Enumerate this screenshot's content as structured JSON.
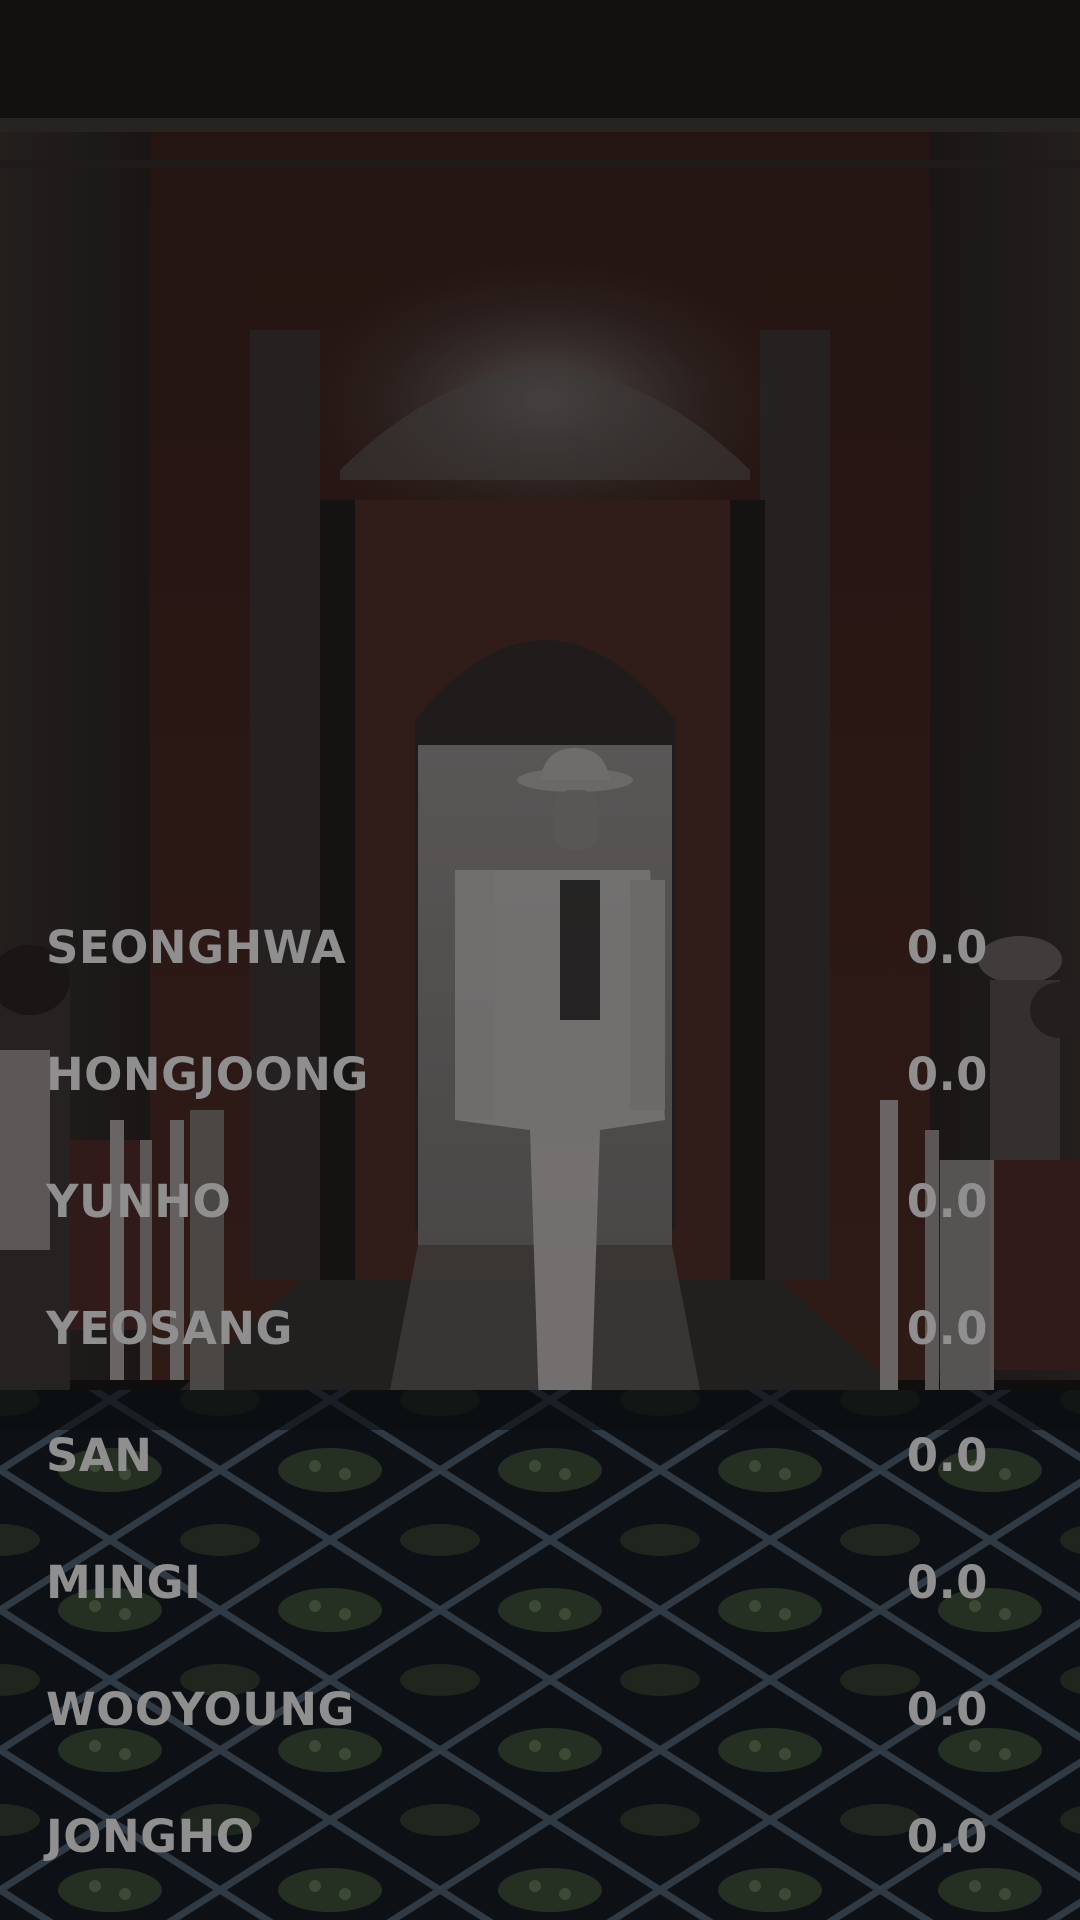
{
  "colors": {
    "text": "#8f8f8f",
    "background": "#151312"
  },
  "members": [
    {
      "name": "SEONGHWA",
      "score": "0.0"
    },
    {
      "name": "HONGJOONG",
      "score": "0.0"
    },
    {
      "name": "YUNHO",
      "score": "0.0"
    },
    {
      "name": "YEOSANG",
      "score": "0.0"
    },
    {
      "name": "SAN",
      "score": "0.0"
    },
    {
      "name": "MINGI",
      "score": "0.0"
    },
    {
      "name": "WOOYOUNG",
      "score": "0.0"
    },
    {
      "name": "JONGHO",
      "score": "0.0"
    }
  ]
}
